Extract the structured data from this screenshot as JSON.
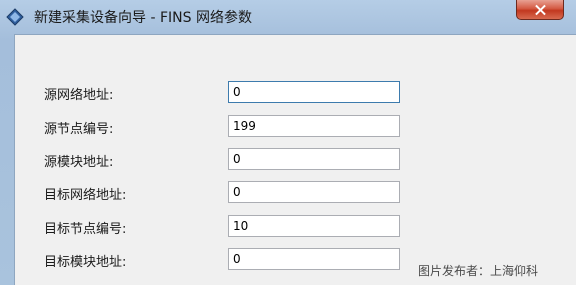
{
  "window": {
    "title": "新建采集设备向导 - FINS 网络参数"
  },
  "form": {
    "fields": [
      {
        "label": "源网络地址:",
        "value": "0"
      },
      {
        "label": "源节点编号:",
        "value": "199"
      },
      {
        "label": "源模块地址:",
        "value": "0"
      },
      {
        "label": "目标网络地址:",
        "value": "0"
      },
      {
        "label": "目标节点编号:",
        "value": "10"
      },
      {
        "label": "目标模块地址:",
        "value": "0"
      }
    ]
  },
  "watermark": "图片发布者：上海仰科"
}
